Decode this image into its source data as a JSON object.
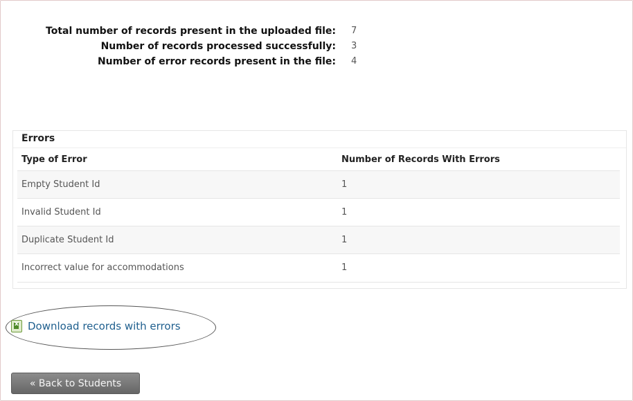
{
  "summary": {
    "rows": [
      {
        "label": "Total number of records present in the uploaded file:",
        "value": "7"
      },
      {
        "label": "Number of records processed successfully:",
        "value": "3"
      },
      {
        "label": "Number of error records present in the file:",
        "value": "4"
      }
    ]
  },
  "errors": {
    "title": "Errors",
    "columns": {
      "type": "Type of Error",
      "count": "Number of Records With Errors"
    },
    "rows": [
      {
        "type": "Empty Student Id",
        "count": "1"
      },
      {
        "type": "Invalid Student Id",
        "count": "1"
      },
      {
        "type": "Duplicate Student Id",
        "count": "1"
      },
      {
        "type": "Incorrect value for accommodations",
        "count": "1"
      }
    ]
  },
  "download": {
    "label": "Download records with errors",
    "icon": "excel-file-icon"
  },
  "back_button": {
    "label": "« Back to Students"
  },
  "colors": {
    "link": "#1f5f8e",
    "button": "#777777",
    "icon_green": "#4e8a2a"
  }
}
